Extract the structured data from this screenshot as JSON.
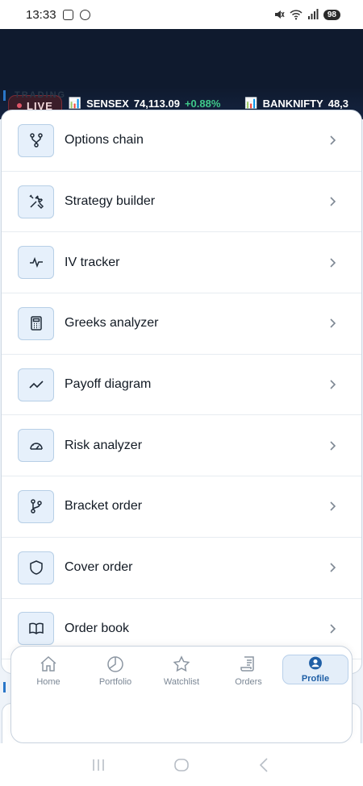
{
  "status": {
    "time": "13:33",
    "battery": "98"
  },
  "ticker": {
    "live_label": "LIVE",
    "items": [
      {
        "icon": "📊",
        "name": "SENSEX",
        "value": "74,113.09",
        "change": "+0.88%"
      },
      {
        "icon": "📊",
        "name": "BANKNIFTY",
        "value": "48,3",
        "change": ""
      }
    ]
  },
  "section": {
    "label": "TRADING"
  },
  "menu": {
    "items": [
      {
        "label": "Options chain",
        "icon": "fork-icon"
      },
      {
        "label": "Strategy builder",
        "icon": "tools-icon"
      },
      {
        "label": "IV tracker",
        "icon": "pulse-icon"
      },
      {
        "label": "Greeks analyzer",
        "icon": "calculator-icon"
      },
      {
        "label": "Payoff diagram",
        "icon": "trend-line-icon"
      },
      {
        "label": "Risk analyzer",
        "icon": "gauge-icon"
      },
      {
        "label": "Bracket order",
        "icon": "branch-icon"
      },
      {
        "label": "Cover order",
        "icon": "shield-icon"
      },
      {
        "label": "Order book",
        "icon": "book-icon"
      }
    ]
  },
  "bottom_nav": {
    "items": [
      {
        "label": "Home",
        "icon": "home-icon",
        "active": false
      },
      {
        "label": "Portfolio",
        "icon": "pie-chart-icon",
        "active": false
      },
      {
        "label": "Watchlist",
        "icon": "star-icon",
        "active": false
      },
      {
        "label": "Orders",
        "icon": "receipt-icon",
        "active": false
      },
      {
        "label": "Profile",
        "icon": "user-icon",
        "active": true
      }
    ]
  },
  "colors": {
    "accent": "#2a76c8",
    "header_bg": "#0f1a2e",
    "positive": "#3fc98a",
    "live_dot": "#e05567"
  }
}
